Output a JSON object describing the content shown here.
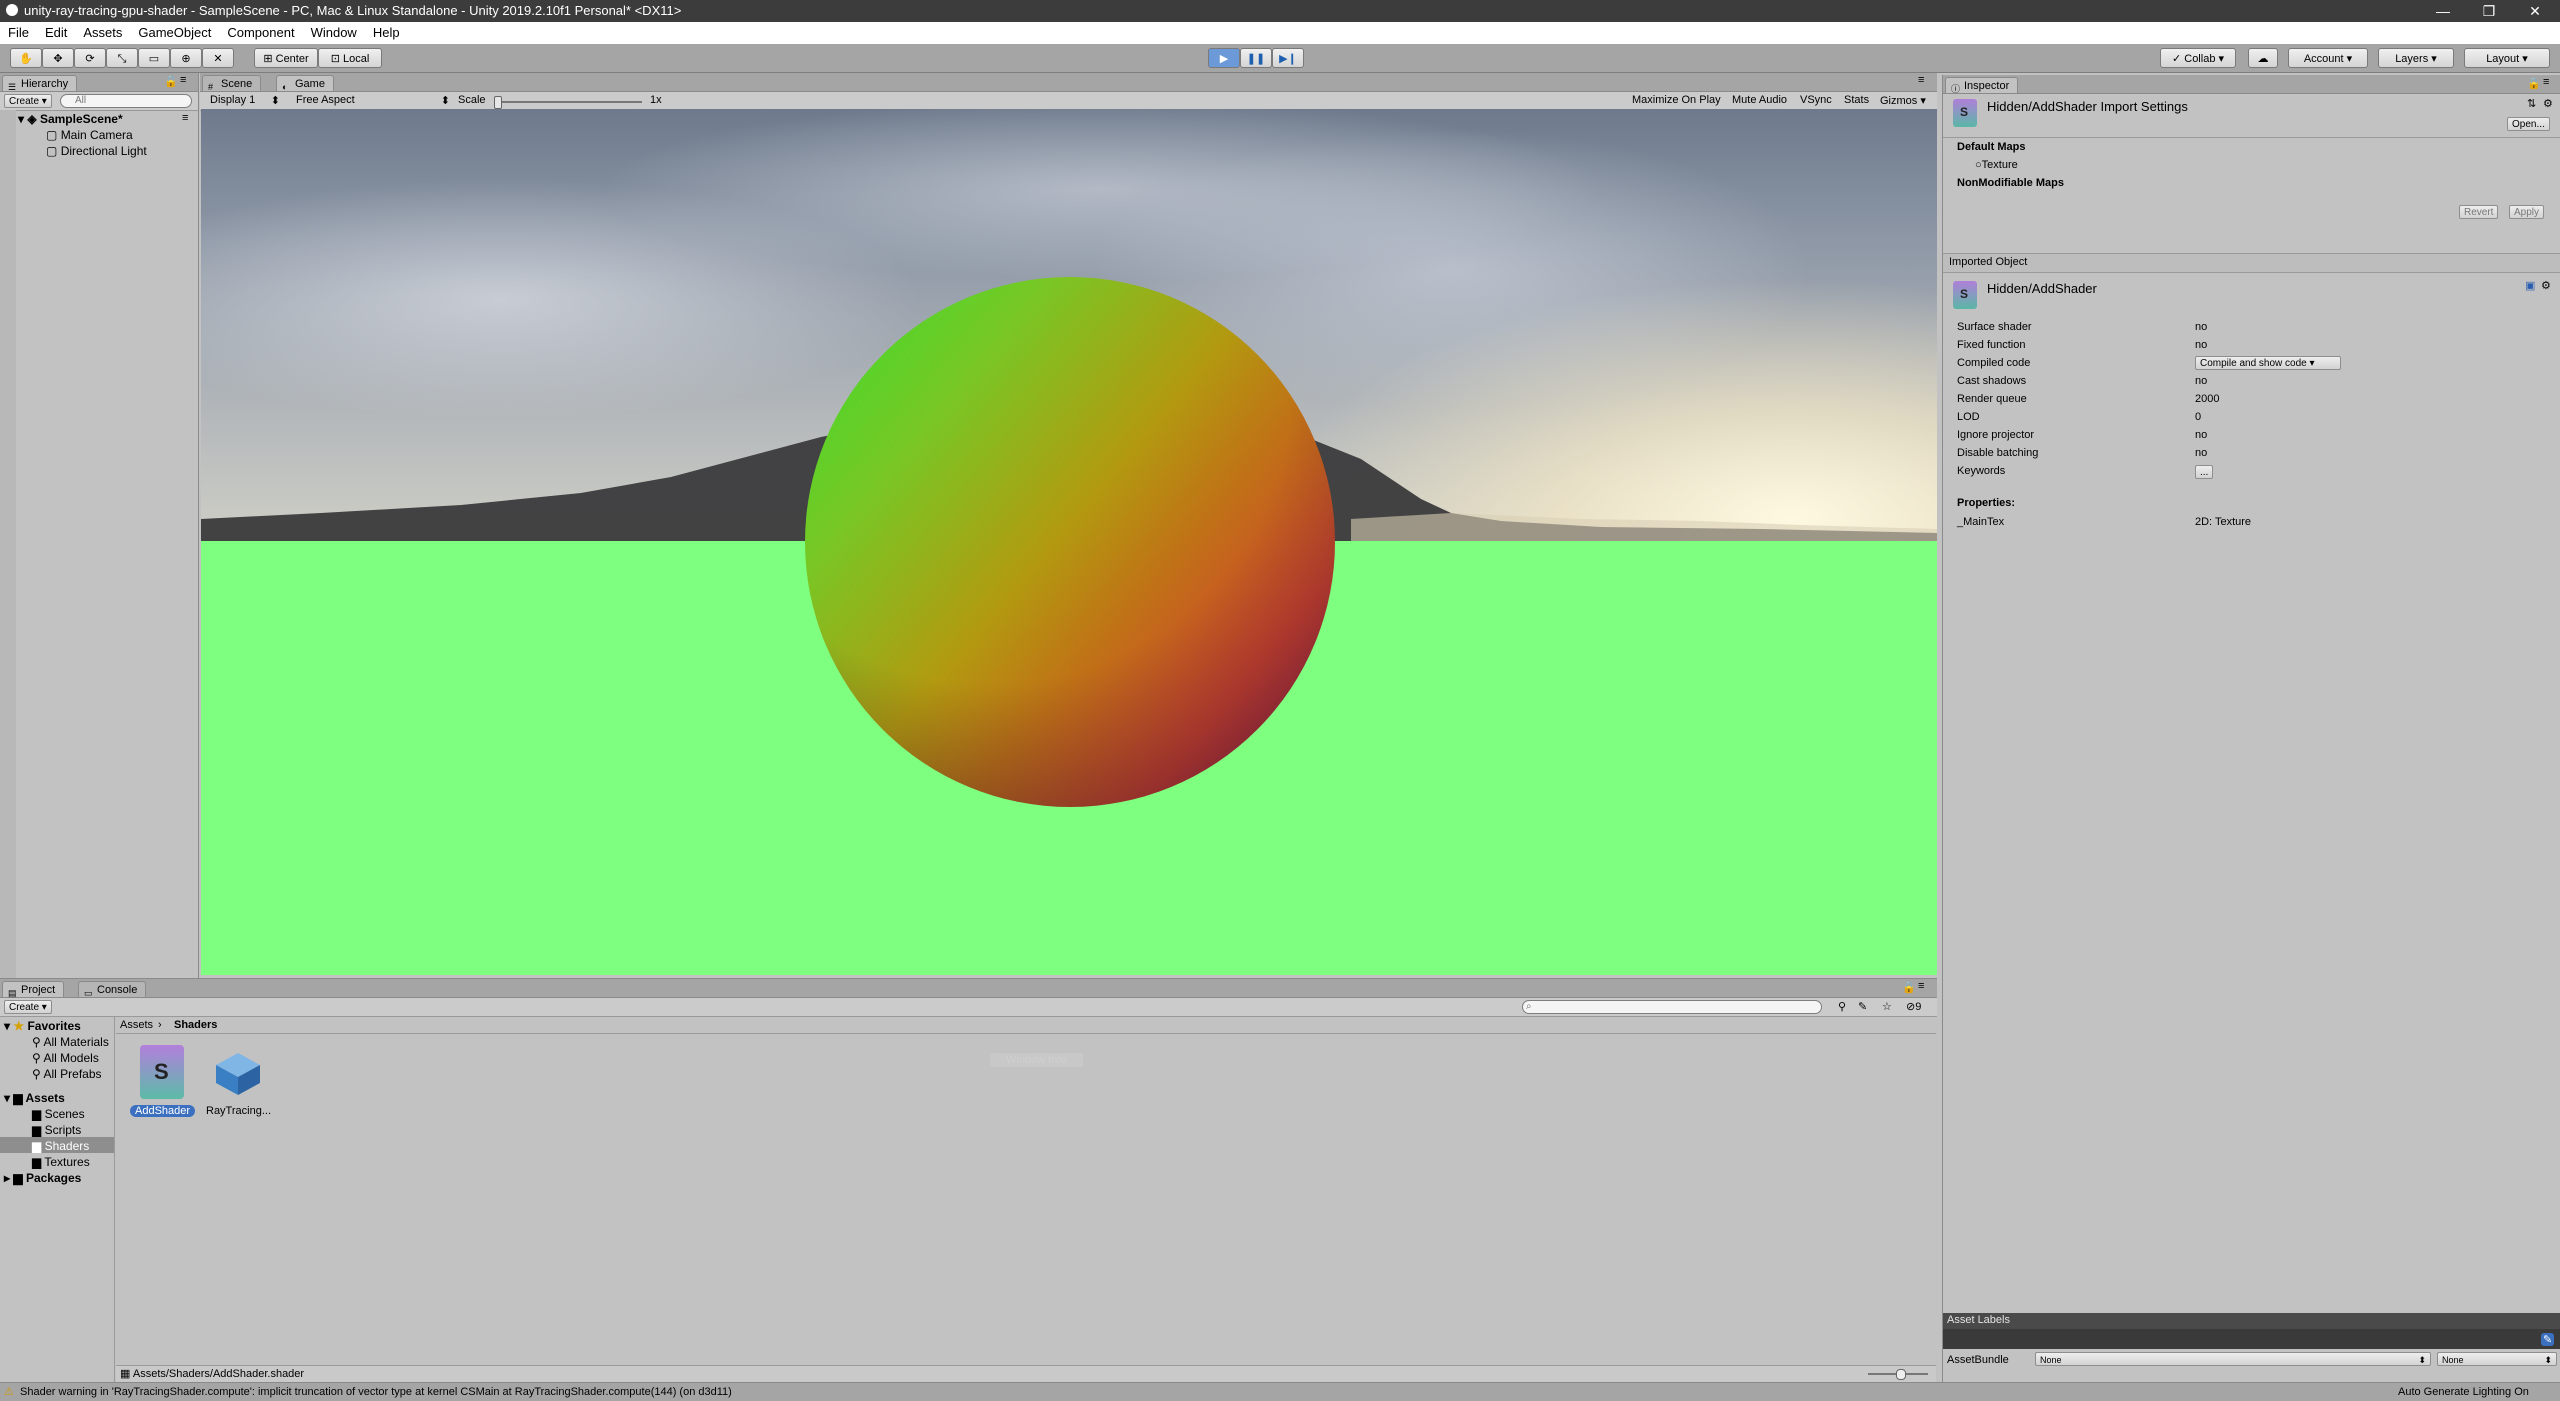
{
  "window": {
    "title": "unity-ray-tracing-gpu-shader - SampleScene - PC, Mac & Linux Standalone - Unity 2019.2.10f1 Personal* <DX11>",
    "controls": [
      "—",
      "❐",
      "✕"
    ]
  },
  "menu": [
    "File",
    "Edit",
    "Assets",
    "GameObject",
    "Component",
    "Window",
    "Help"
  ],
  "toolbar": {
    "pivot_label": "Center",
    "space_label": "Local",
    "collab_label": "Collab ▾",
    "account_label": "Account",
    "layers_label": "Layers",
    "layout_label": "Layout"
  },
  "hierarchy": {
    "tab_label": "Hierarchy",
    "create_label": "Create ▾",
    "search_placeholder": "All",
    "scene_name": "SampleScene*",
    "items": [
      "Main Camera",
      "Directional Light"
    ]
  },
  "game_view": {
    "tabs": [
      "Scene",
      "Game"
    ],
    "display_label": "Display 1",
    "aspect_label": "Free Aspect",
    "scale_label": "Scale",
    "scale_value": "1x",
    "options": [
      "Maximize On Play",
      "Mute Audio",
      "VSync",
      "Stats",
      "Gizmos"
    ],
    "ground_color": "#7fff7f"
  },
  "inspector": {
    "tab_label": "Inspector",
    "header_title": "Hidden/AddShader Import Settings",
    "open_label": "Open...",
    "default_maps_label": "Default Maps",
    "texture_label": "Texture",
    "nonmodifiable_label": "NonModifiable Maps",
    "revert_label": "Revert",
    "apply_label": "Apply",
    "imported_object_label": "Imported Object",
    "object_name": "Hidden/AddShader",
    "properties_rows": [
      {
        "label": "Surface shader",
        "value": "no"
      },
      {
        "label": "Fixed function",
        "value": "no"
      },
      {
        "label": "Compiled code",
        "value": "Compile and show code"
      },
      {
        "label": "Cast shadows",
        "value": "no"
      },
      {
        "label": "Render queue",
        "value": "2000"
      },
      {
        "label": "LOD",
        "value": "0"
      },
      {
        "label": "Ignore projector",
        "value": "no"
      },
      {
        "label": "Disable batching",
        "value": "no"
      },
      {
        "label": "Keywords",
        "value": "..."
      }
    ],
    "properties_heading": "Properties:",
    "property_name": "_MainTex",
    "property_type": "2D: Texture",
    "asset_labels_label": "Asset Labels",
    "assetbundle_label": "AssetBundle",
    "assetbundle_value": "None",
    "assetbundle_variant": "None"
  },
  "project": {
    "tabs": [
      "Project",
      "Console"
    ],
    "create_label": "Create ▾",
    "favorites_label": "Favorites",
    "favorites": [
      "All Materials",
      "All Models",
      "All Prefabs"
    ],
    "assets_label": "Assets",
    "asset_folders": [
      "Scenes",
      "Scripts",
      "Shaders",
      "Textures"
    ],
    "packages_label": "Packages",
    "breadcrumb": [
      "Assets",
      "Shaders"
    ],
    "files": [
      {
        "name": "AddShader",
        "selected": true
      },
      {
        "name": "RayTracing...",
        "selected": false
      }
    ],
    "selected_path": "Assets/Shaders/AddShader.shader",
    "ghost_text": "Window Info"
  },
  "status": {
    "message": "Shader warning in 'RayTracingShader.compute': implicit truncation of vector type at kernel CSMain at RayTracingShader.compute(144) (on d3d11)",
    "right_text": "Auto Generate Lighting On"
  }
}
